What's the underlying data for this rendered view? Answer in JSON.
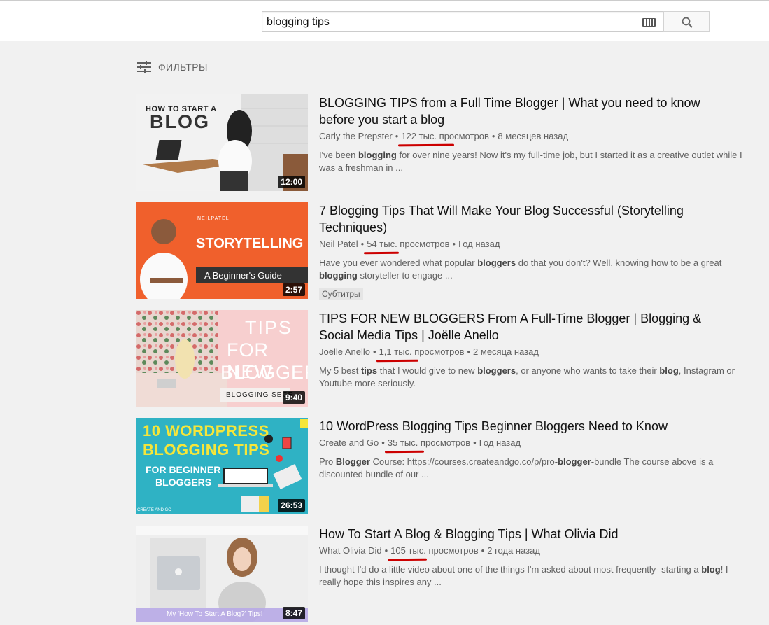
{
  "search": {
    "query": "blogging tips"
  },
  "filters": {
    "label": "ФИЛЬТРЫ"
  },
  "videos": [
    {
      "title": "BLOGGING TIPS from a Full Time Blogger | What you need to know before you start a blog",
      "channel": "Carly the Prepster",
      "views": "122 тыс. просмотров",
      "age": "8 месяцев назад",
      "description": "I've been blogging for over nine years! Now it's my full-time job, but I started it as a creative outlet while I was a freshman in ...",
      "duration": "12:00",
      "thumb_text_1": "HOW TO START A",
      "thumb_text_2": "BLOG"
    },
    {
      "title": "7 Blogging Tips That Will Make Your Blog Successful (Storytelling Techniques)",
      "channel": "Neil Patel",
      "views": "54 тыс. просмотров",
      "age": "Год назад",
      "description": "Have you ever wondered what popular bloggers do that you don't? Well, knowing how to be a great blogging storyteller to engage ...",
      "duration": "2:57",
      "badge": "Субтитры",
      "thumb_text_1": "NEILPATEL",
      "thumb_text_2": "STORYTELLING",
      "thumb_text_3": "A Beginner's Guide"
    },
    {
      "title": "TIPS FOR NEW BLOGGERS From A Full-Time Blogger | Blogging & Social Media Tips | Joëlle Anello",
      "channel": "Joëlle Anello",
      "views": "1,1 тыс. просмотров",
      "age": "2 месяца назад",
      "description": "My 5 best tips that I would give to new bloggers, or anyone who wants to take their blog, Instagram or Youtube more seriously.",
      "duration": "9:40",
      "thumb_text_1": "TIPS",
      "thumb_text_2": "FOR NEW",
      "thumb_text_3": "BLOGGERS",
      "thumb_text_4": "BLOGGING SECR"
    },
    {
      "title": "10 WordPress Blogging Tips Beginner Bloggers Need to Know",
      "channel": "Create and Go",
      "views": "35 тыс. просмотров",
      "age": "Год назад",
      "description": "Pro Blogger Course: https://courses.createandgo.co/p/pro-blogger-bundle The course above is a discounted bundle of our ...",
      "duration": "26:53",
      "thumb_text_1": "10 WORDPRESS",
      "thumb_text_2": "BLOGGING TIPS",
      "thumb_text_3": "FOR BEGINNER",
      "thumb_text_4": "BLOGGERS",
      "thumb_text_5": "CREATE AND GO"
    },
    {
      "title": "How To Start A Blog & Blogging Tips | What Olivia Did",
      "channel": "What Olivia Did",
      "views": "105 тыс. просмотров",
      "age": "2 года назад",
      "description": "I thought I'd do a little video about one of the things I'm asked about most frequently- starting a blog! I really hope this inspires any ...",
      "duration": "8:47",
      "thumb_text_1": "My 'How To Start A Blog?' Tips!"
    }
  ],
  "colors": {
    "underline": "#cc0000",
    "meta": "#606060",
    "thumb2_bg": "#f0602c",
    "thumb4_bg": "#2fb2c4",
    "thumb4_text": "#f5e63a"
  }
}
